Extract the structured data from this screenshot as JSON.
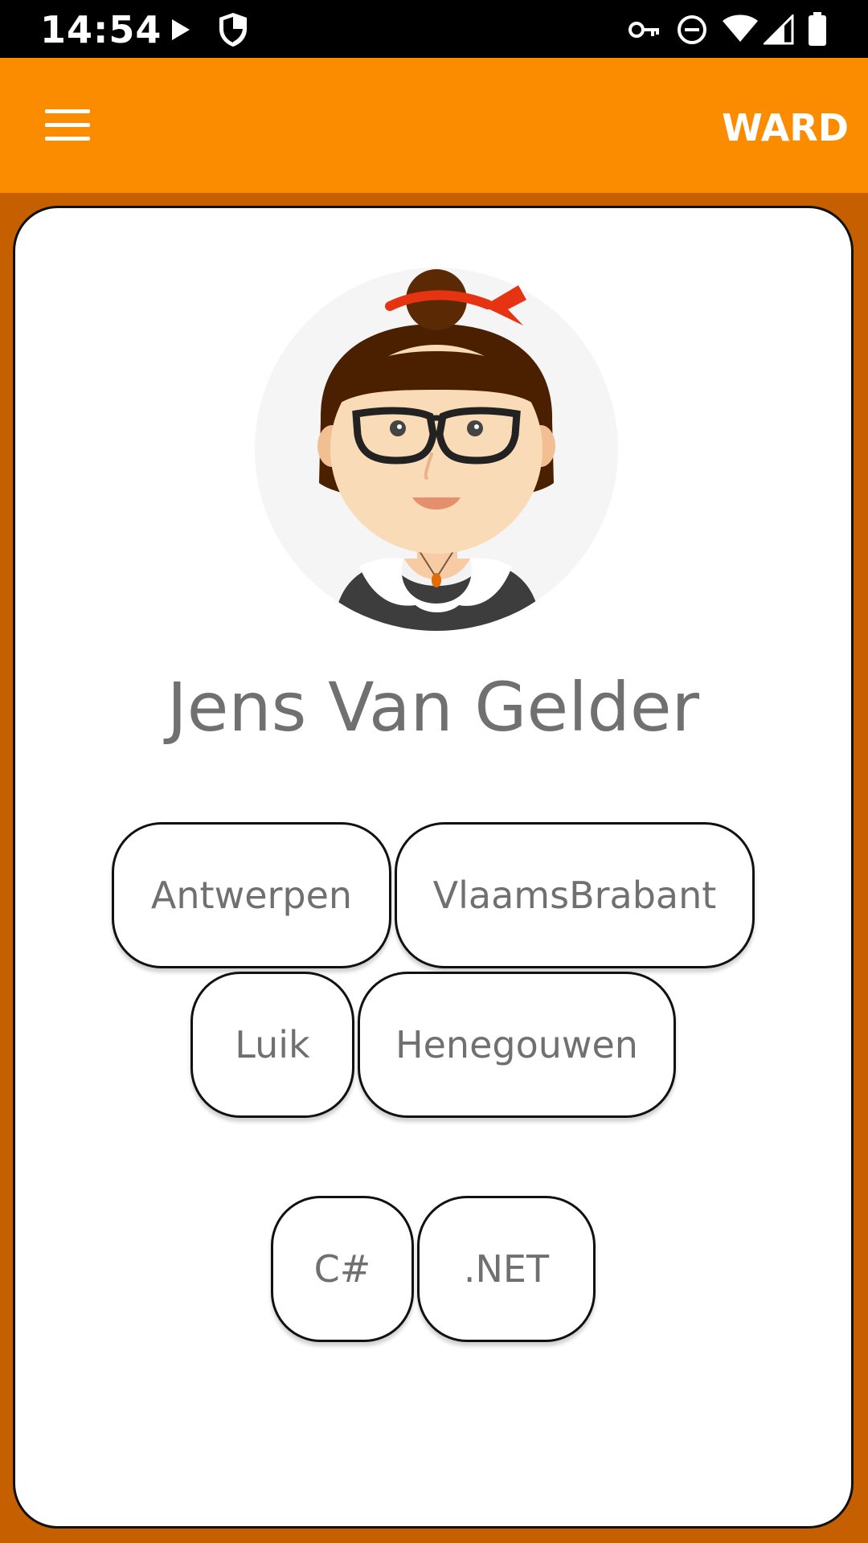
{
  "status_bar": {
    "time": "14:54",
    "icons": [
      "play-icon",
      "shield-icon",
      "vpn-key-icon",
      "do-not-disturb-icon",
      "wifi-icon",
      "cell-signal-icon",
      "battery-icon"
    ]
  },
  "app_bar": {
    "menu_icon": "hamburger-menu-icon",
    "action_label": "WARD",
    "color": "#fb8c00"
  },
  "profile": {
    "name": "Jens Van Gelder",
    "avatar": "female-avatar-illustration"
  },
  "regions": [
    "Antwerpen",
    "VlaamsBrabant",
    "Luik",
    "Henegouwen"
  ],
  "skills": [
    "C#",
    ".NET"
  ],
  "colors": {
    "background": "#c55f00",
    "accent": "#fb8c00",
    "card": "#ffffff",
    "text": "#707070"
  }
}
